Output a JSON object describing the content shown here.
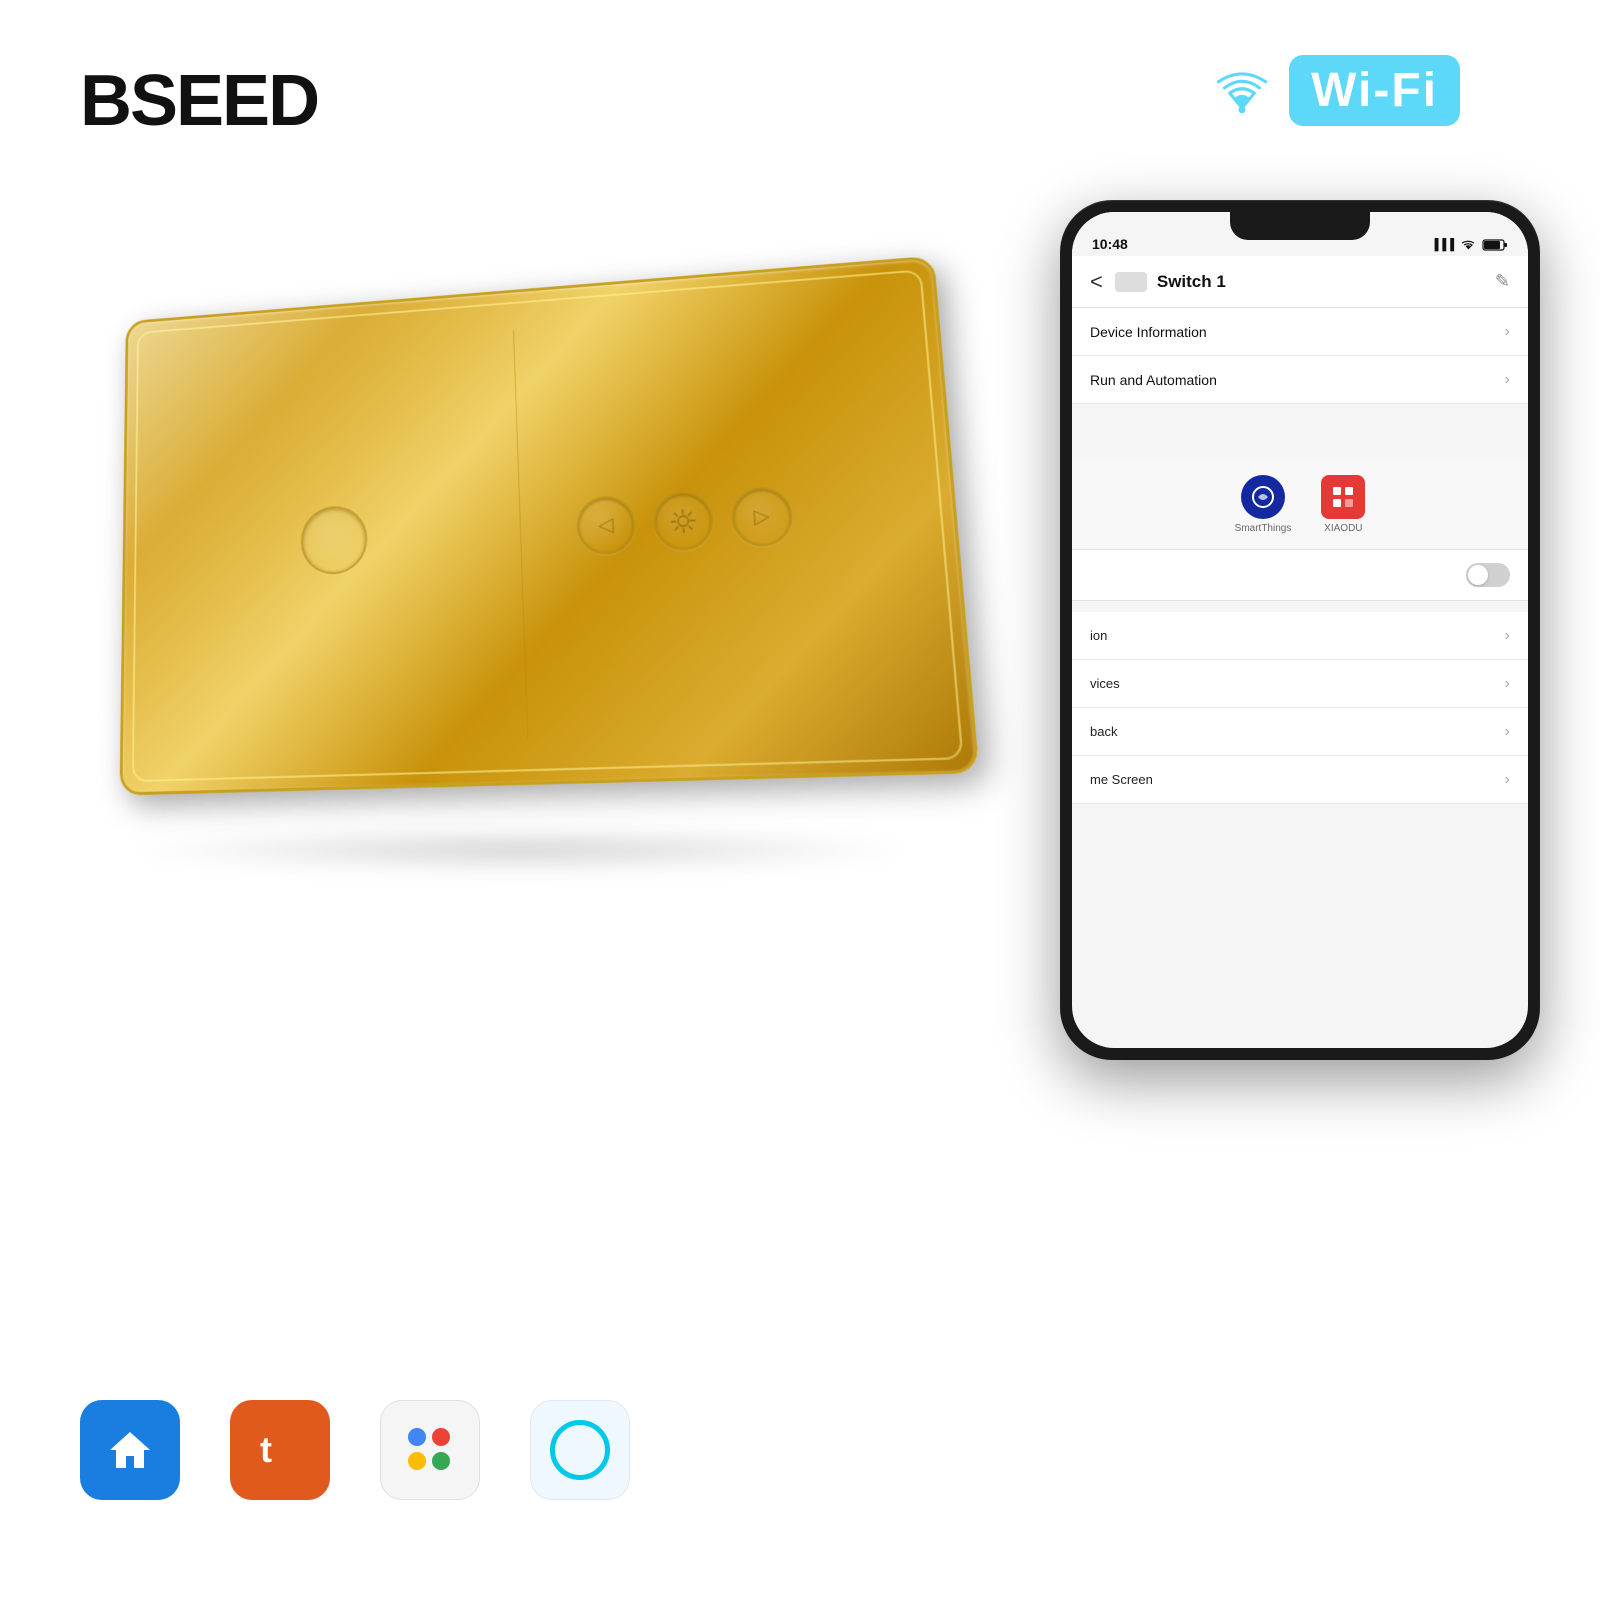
{
  "brand": {
    "logo": "BSEED",
    "wifi_label": "Wi-Fi"
  },
  "phone": {
    "status_time": "10:48",
    "signal_icon": "▌▌▌",
    "wifi_icon": "WiFi",
    "battery_icon": "🔋",
    "back_label": "<",
    "switch_name": "Switch 1",
    "edit_icon": "✎",
    "menu_items": [
      {
        "label": "Device Information",
        "has_chevron": true
      },
      {
        "label": "Run and Automation",
        "has_chevron": true
      }
    ],
    "integrations": [
      {
        "label": "SmartThings",
        "color": "#1428A0"
      },
      {
        "label": "XIAODU",
        "color": "#e53935"
      }
    ],
    "list_items": [
      {
        "label": "ion",
        "has_chevron": true
      },
      {
        "label": "vices",
        "has_chevron": true
      },
      {
        "label": "back",
        "has_chevron": true
      },
      {
        "label": "me Screen",
        "has_chevron": true
      }
    ]
  },
  "bottom_apps": [
    {
      "name": "SmartLife",
      "color": "#1a7de0"
    },
    {
      "name": "Tuya",
      "color": "#e05a1e"
    },
    {
      "name": "Google Home",
      "color": "#f5f5f5"
    },
    {
      "name": "Alexa",
      "color": "#f0f8ff"
    }
  ]
}
